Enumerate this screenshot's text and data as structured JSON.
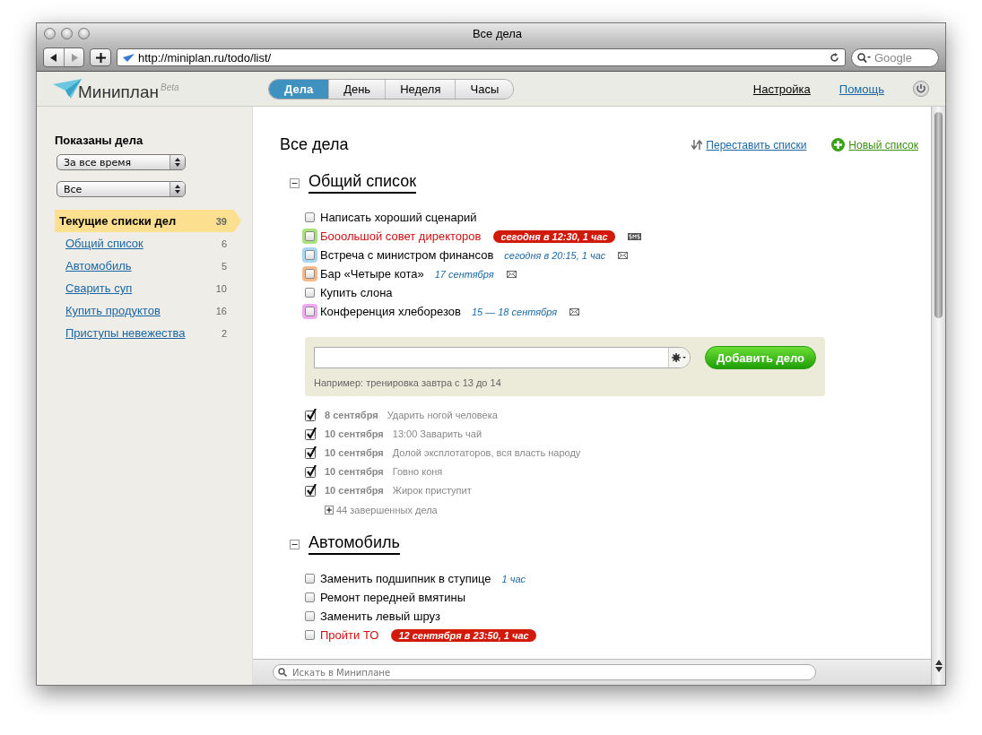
{
  "window": {
    "title": "Все дела"
  },
  "toolbar": {
    "url": "http://miniplan.ru/todo/list/",
    "search_placeholder": "Google"
  },
  "header": {
    "logo": "Миниплан",
    "logo_badge": "Beta",
    "tabs": [
      {
        "label": "Дела",
        "selected": true
      },
      {
        "label": "День",
        "selected": false
      },
      {
        "label": "Неделя",
        "selected": false
      },
      {
        "label": "Часы",
        "selected": false
      }
    ],
    "links": [
      {
        "label": "Настройка",
        "kind": "plain"
      },
      {
        "label": "Помощь",
        "kind": "blue"
      }
    ]
  },
  "sidebar": {
    "title": "Показаны дела",
    "filters": [
      "За все время",
      "Все"
    ],
    "lists": [
      {
        "label": "Текущие списки дел",
        "count": "39",
        "selected": true
      },
      {
        "label": "Общий список",
        "count": "6",
        "selected": false
      },
      {
        "label": "Автомобиль",
        "count": "5",
        "selected": false
      },
      {
        "label": "Сварить суп",
        "count": "10",
        "selected": false
      },
      {
        "label": "Купить продуктов",
        "count": "16",
        "selected": false
      },
      {
        "label": "Приступы невежества",
        "count": "2",
        "selected": false
      }
    ]
  },
  "main": {
    "title": "Все дела",
    "actions": [
      {
        "label": "Переставить списки",
        "kind": "reorder"
      },
      {
        "label": "Новый список",
        "kind": "new"
      }
    ],
    "sections": [
      {
        "title": "Общий список",
        "expanded": true,
        "tasks": [
          {
            "text": "Написать хороший сценарий",
            "checked": false,
            "overdue": false
          },
          {
            "text": "Бооольшой совет директоров",
            "checked": false,
            "overdue": true,
            "color": "#a9e27c",
            "when": "сегодня в 12:30, 1 час",
            "reminder": {
              "kind": "sms"
            }
          },
          {
            "text": "Встреча с министром финансов",
            "checked": false,
            "overdue": false,
            "color": "#a9d5f3",
            "when": "сегодня в 20:15, 1 час",
            "reminder": {
              "kind": "mail"
            }
          },
          {
            "text": "Бар «Четыре кота»",
            "checked": false,
            "overdue": false,
            "color": "#f5b98b",
            "when": "17 сентября",
            "reminder": {
              "kind": "mail"
            }
          },
          {
            "text": "Купить слона",
            "checked": false,
            "overdue": false
          },
          {
            "text": "Конференция хлеборезов",
            "checked": false,
            "overdue": false,
            "color": "#f2a9f2",
            "when": "15 — 18 сентября",
            "reminder": {
              "kind": "mail"
            }
          }
        ],
        "add_form": {
          "hint": "Например: тренировка завтра с 13 до 14",
          "button": "Добавить дело"
        },
        "done": [
          {
            "date": "8 сентября",
            "text": "Ударить ногой человека",
            "checked": true
          },
          {
            "date": "10 сентября",
            "text": "13:00 Заварить чай",
            "checked": true
          },
          {
            "date": "10 сентября",
            "text": "Долой эксплотаторов, вся власть народу",
            "checked": true
          },
          {
            "date": "10 сентября",
            "text": "Говно коня",
            "checked": true
          },
          {
            "date": "10 сентября",
            "text": "Жирок приступит",
            "checked": true
          }
        ],
        "more": "44 завершенных дела"
      },
      {
        "title": "Автомобиль",
        "expanded": true,
        "tasks": [
          {
            "text": "Заменить подшипник в ступице",
            "checked": false,
            "overdue": false,
            "when": "1 час"
          },
          {
            "text": "Ремонт передней вмятины",
            "checked": false,
            "overdue": false
          },
          {
            "text": "Заменить левый шруз",
            "checked": false,
            "overdue": false
          },
          {
            "text": "Пройти ТО",
            "checked": false,
            "overdue": true,
            "when": "12 сентября в 23:50, 1 час"
          }
        ]
      }
    ]
  },
  "search": {
    "placeholder": "Искать в Миниплане"
  }
}
